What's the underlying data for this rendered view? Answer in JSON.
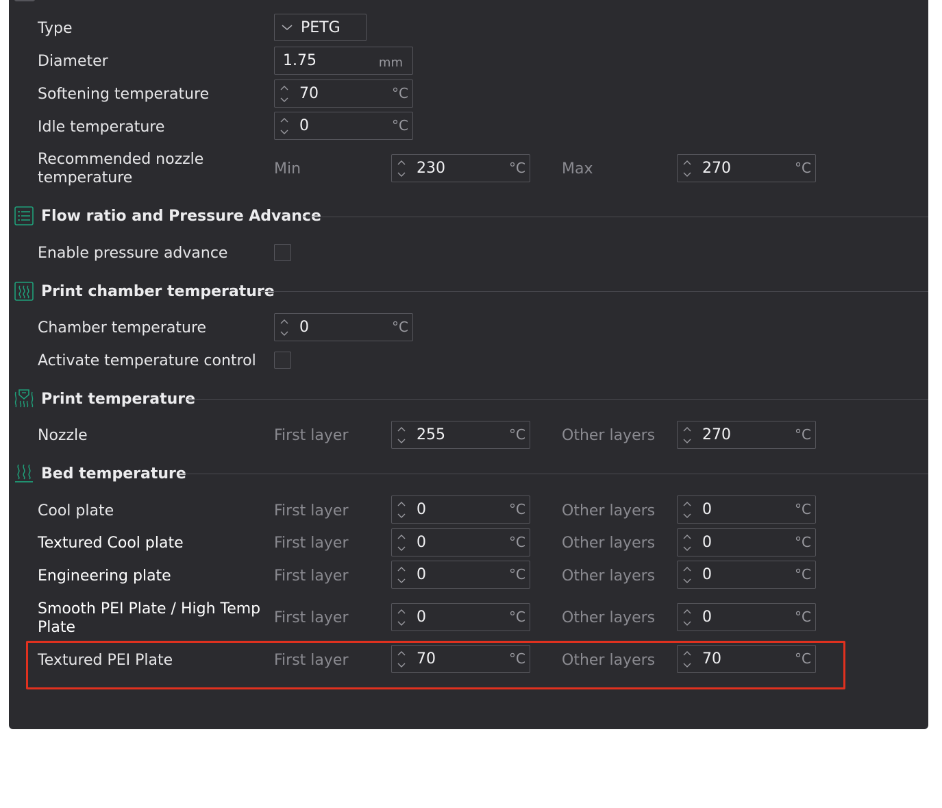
{
  "filament": {
    "type_label": "Type",
    "type_value": "PETG",
    "diameter_label": "Diameter",
    "diameter_value": "1.75",
    "diameter_unit": "mm",
    "softening_label": "Softening temperature",
    "softening_value": "70",
    "idle_label": "Idle temperature",
    "idle_value": "0",
    "nozzle_range_label": "Recommended nozzle temperature",
    "min_label": "Min",
    "min_value": "230",
    "max_label": "Max",
    "max_value": "270",
    "temp_unit": "°C"
  },
  "flow": {
    "title": "Flow ratio and Pressure Advance",
    "pressure_label": "Enable pressure advance"
  },
  "chamber": {
    "title": "Print chamber temperature",
    "chamber_label": "Chamber temperature",
    "chamber_value": "0",
    "activate_label": "Activate temperature control"
  },
  "print_temp": {
    "title": "Print temperature",
    "nozzle_label": "Nozzle",
    "first_layer_label": "First layer",
    "first_layer_value": "255",
    "other_layers_label": "Other layers",
    "other_layers_value": "270"
  },
  "bed": {
    "title": "Bed temperature",
    "first_layer_label": "First layer",
    "other_layers_label": "Other layers",
    "plates": [
      {
        "name": "Cool plate",
        "first": "0",
        "other": "0"
      },
      {
        "name": "Textured Cool plate",
        "first": "0",
        "other": "0"
      },
      {
        "name": "Engineering plate",
        "first": "0",
        "other": "0"
      },
      {
        "name": "Smooth PEI Plate / High Temp Plate",
        "first": "0",
        "other": "0"
      },
      {
        "name": "Textured PEI Plate",
        "first": "70",
        "other": "70"
      }
    ]
  },
  "colors": {
    "panel_bg": "#2b2b2f",
    "accent_green": "#1fa07a",
    "highlight_red": "#e0311f"
  }
}
